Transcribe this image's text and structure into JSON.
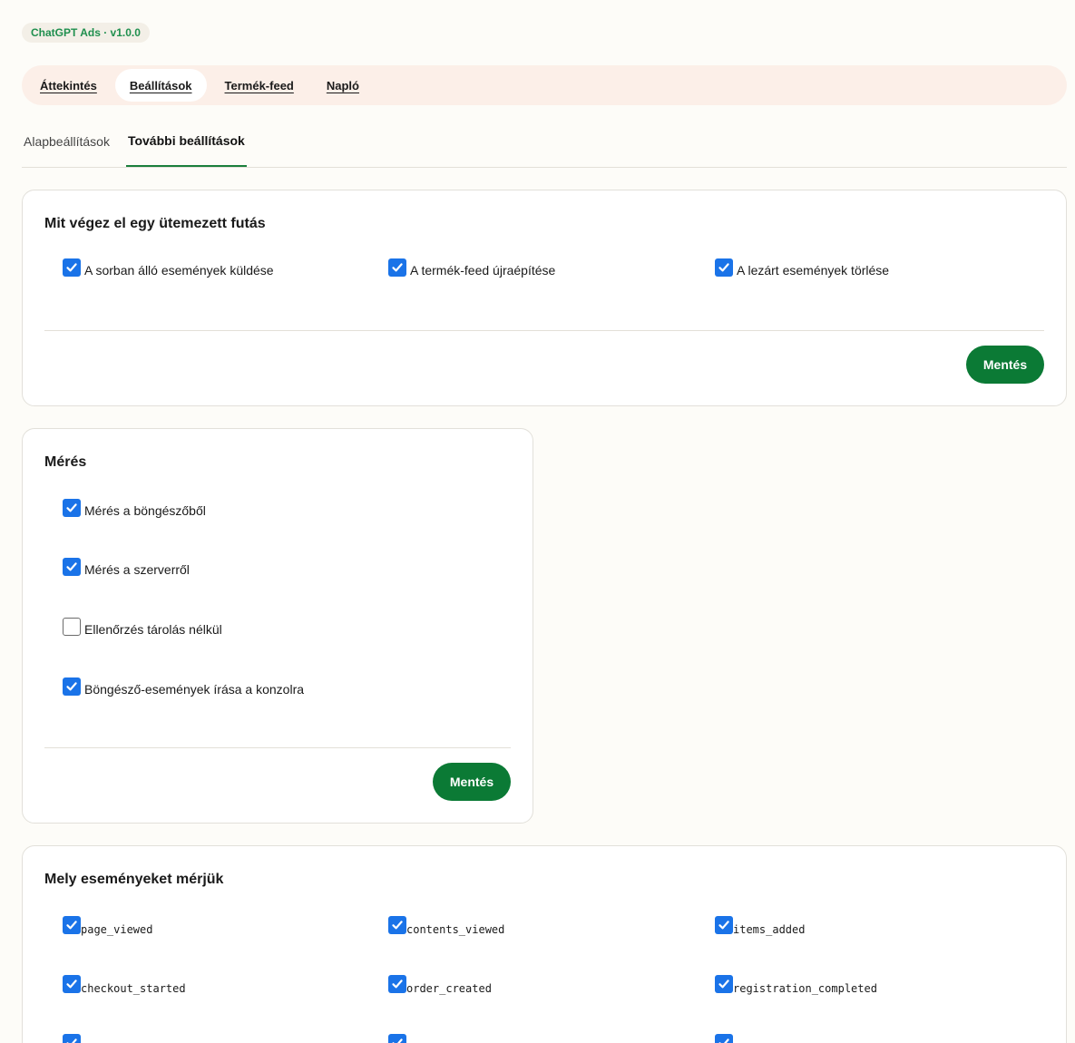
{
  "version_badge": "ChatGPT Ads · v1.0.0",
  "main_nav": {
    "tabs": [
      "Áttekintés",
      "Beállítások",
      "Termék-feed",
      "Napló"
    ],
    "active": "Beállítások"
  },
  "sub_tabs": {
    "tabs": [
      "Alapbeállítások",
      "További beállítások"
    ],
    "active": "További beállítások"
  },
  "scheduled_card": {
    "title": "Mit végez el egy ütemezett futás",
    "options": [
      {
        "label": "A sorban álló események küldése",
        "checked": true
      },
      {
        "label": "A termék-feed újraépítése",
        "checked": true
      },
      {
        "label": "A lezárt események törlése",
        "checked": true
      }
    ],
    "save_label": "Mentés"
  },
  "measurement_card": {
    "title": "Mérés",
    "options": [
      {
        "label": "Mérés a böngészőből",
        "checked": true
      },
      {
        "label": "Mérés a szerverről",
        "checked": true
      },
      {
        "label": "Ellenőrzés tárolás nélkül",
        "checked": false
      },
      {
        "label": "Böngésző-események írása a konzolra",
        "checked": true
      }
    ],
    "save_label": "Mentés"
  },
  "events_card": {
    "title": "Mely eseményeket mérjük",
    "events": [
      {
        "label": "page_viewed",
        "checked": true
      },
      {
        "label": "contents_viewed",
        "checked": true
      },
      {
        "label": "items_added",
        "checked": true
      },
      {
        "label": "checkout_started",
        "checked": true
      },
      {
        "label": "order_created",
        "checked": true
      },
      {
        "label": "registration_completed",
        "checked": true
      },
      {
        "label": "",
        "checked": true
      },
      {
        "label": "",
        "checked": true
      },
      {
        "label": "",
        "checked": true
      }
    ]
  },
  "colors": {
    "accent_green": "#0b7a35",
    "checkbox_blue": "#1a73e8",
    "nav_bg": "#fcefe8",
    "page_bg": "#fdfcf8"
  }
}
